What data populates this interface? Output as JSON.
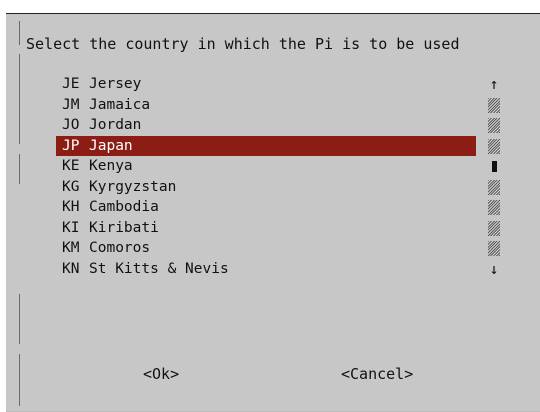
{
  "dialog": {
    "title": "Select the country in which the Pi is to be used",
    "items": [
      {
        "code": "JE",
        "name": "Jersey",
        "selected": false
      },
      {
        "code": "JM",
        "name": "Jamaica",
        "selected": false
      },
      {
        "code": "JO",
        "name": "Jordan",
        "selected": false
      },
      {
        "code": "JP",
        "name": "Japan",
        "selected": true
      },
      {
        "code": "KE",
        "name": "Kenya",
        "selected": false
      },
      {
        "code": "KG",
        "name": "Kyrgyzstan",
        "selected": false
      },
      {
        "code": "KH",
        "name": "Cambodia",
        "selected": false
      },
      {
        "code": "KI",
        "name": "Kiribati",
        "selected": false
      },
      {
        "code": "KM",
        "name": "Comoros",
        "selected": false
      },
      {
        "code": "KN",
        "name": "St Kitts & Nevis",
        "selected": false
      }
    ],
    "scrollbar": {
      "up_arrow": "↑",
      "down_arrow": "↓",
      "cells": [
        "up-arrow",
        "track",
        "track",
        "track",
        "thumb",
        "track",
        "track",
        "track",
        "track",
        "down-arrow"
      ]
    },
    "buttons": {
      "ok_label": "<Ok>",
      "cancel_label": "<Cancel>"
    },
    "colors": {
      "background": "#c7c7c7",
      "selection": "#8c1d14",
      "selection_text": "#ffffff"
    }
  }
}
